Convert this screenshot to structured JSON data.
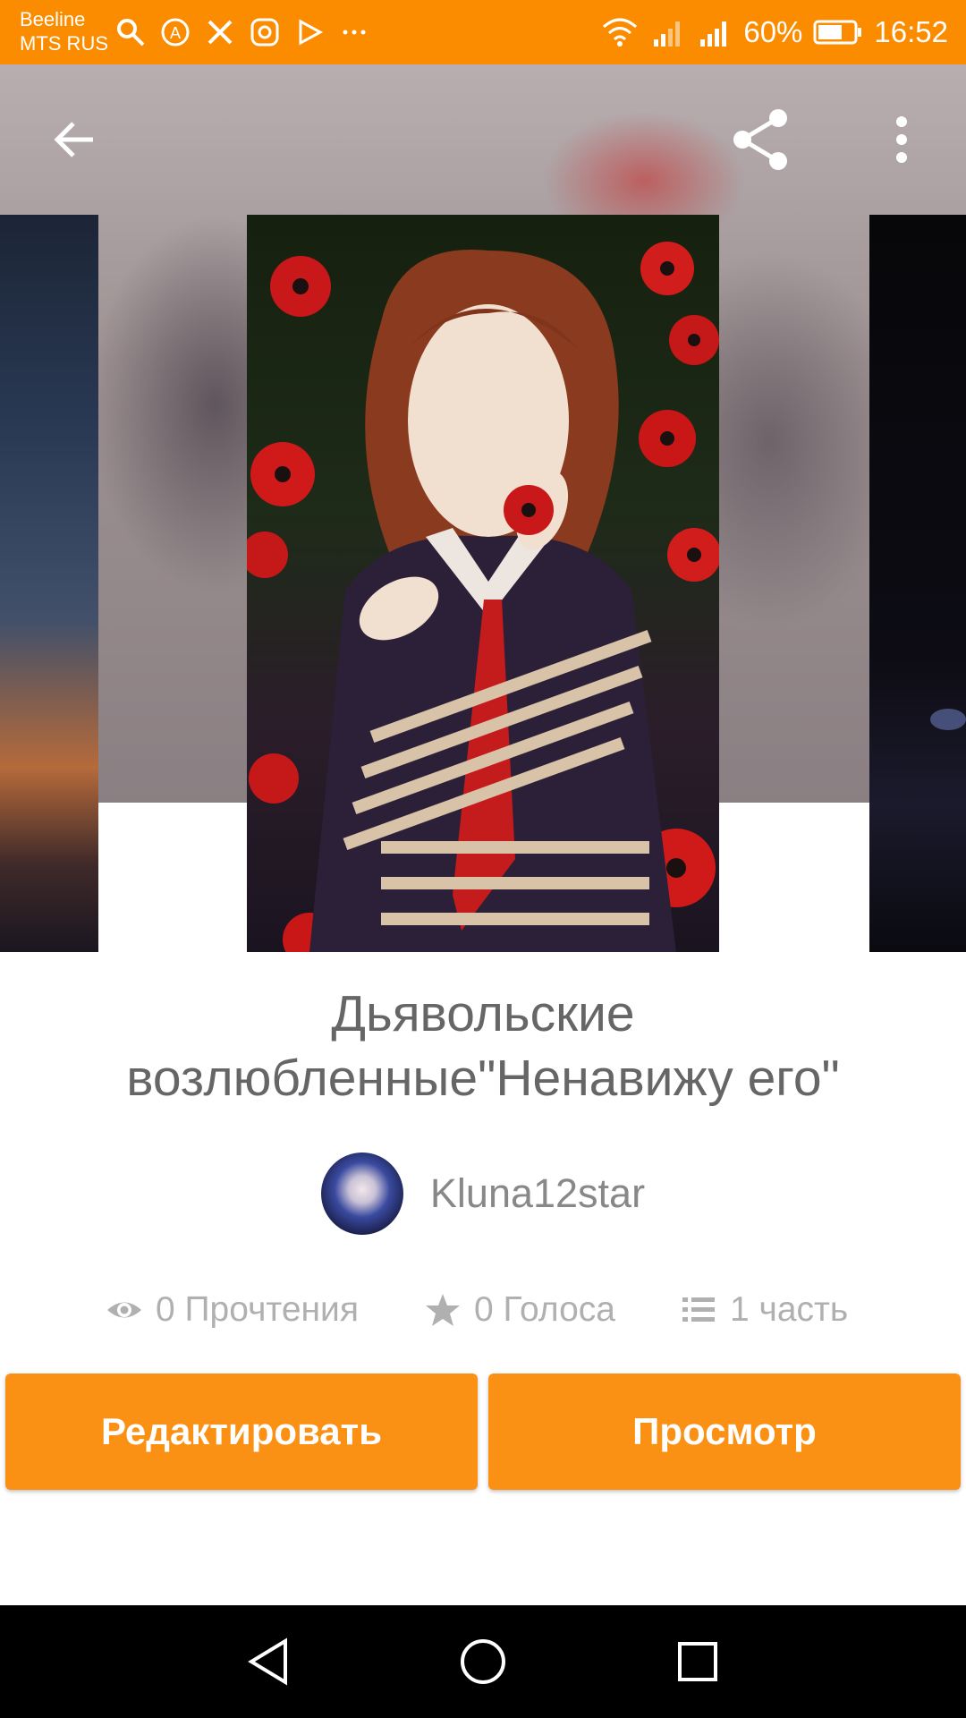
{
  "status_bar": {
    "carrier_1": "Beeline",
    "carrier_2": "MTS RUS",
    "battery": "60%",
    "time": "16:52"
  },
  "top_bar": {
    "back": "arrow-left-icon",
    "share": "share-icon",
    "more": "more-vert-icon"
  },
  "story": {
    "title": "Дьявольские возлюбленные\"Ненавижу его\"",
    "author": "Kluna12star",
    "stats": {
      "reads": "0 Прочтения",
      "votes": "0 Голоса",
      "parts": "1 часть"
    }
  },
  "actions": {
    "edit_label": "Редактировать",
    "view_label": "Просмотр"
  },
  "colors": {
    "accent": "#fb8c00",
    "button": "#fb9114",
    "title_text": "#666666",
    "stat_text": "#b0b0b0"
  }
}
